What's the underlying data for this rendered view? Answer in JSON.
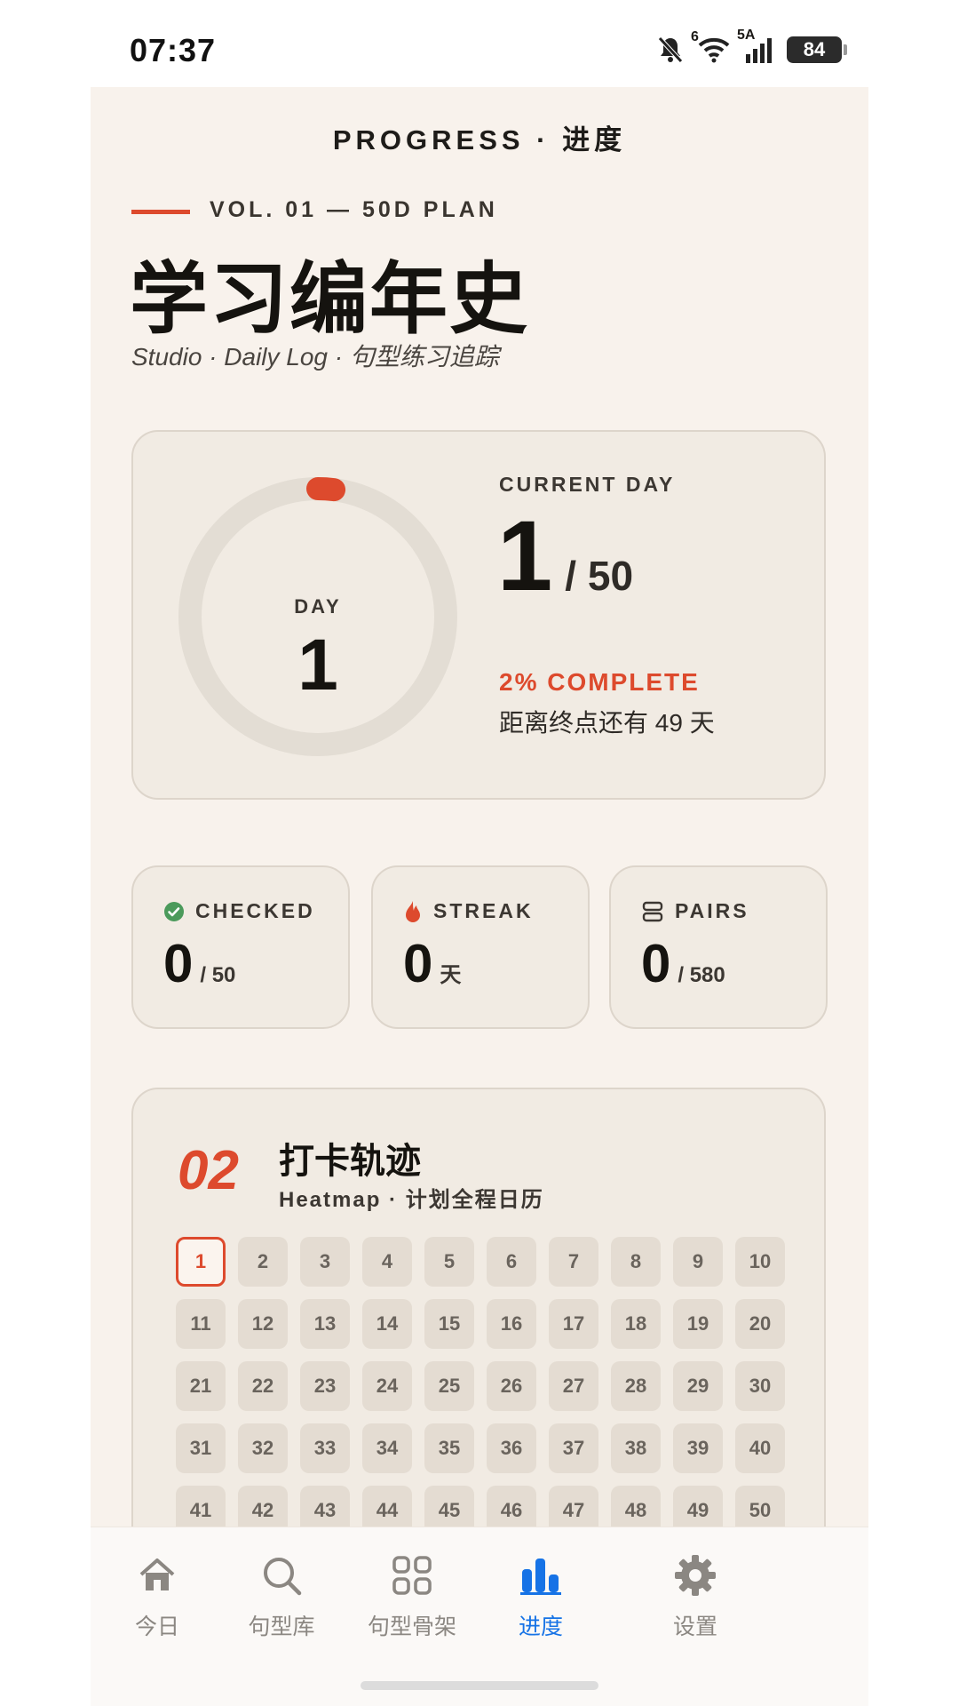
{
  "status_bar": {
    "time": "07:37",
    "network": "5A",
    "wifi": "6",
    "battery": "84",
    "icons": [
      "bell-muted-icon",
      "wifi-icon",
      "signal-icon",
      "battery-icon"
    ]
  },
  "header": {
    "title": "PROGRESS · 进度"
  },
  "hero_text": {
    "vol_label": "VOL. 01 — 50D PLAN",
    "title": "学习编年史",
    "subtitle": "Studio · Daily Log · 句型练习追踪"
  },
  "progress_card": {
    "ring_label": "DAY",
    "ring_value": "1",
    "progress_fraction": 0.02,
    "current_label": "CURRENT DAY",
    "current_value": "1",
    "current_total": "/ 50",
    "percent_text": "2% COMPLETE",
    "remaining_text": "距离终点还有 49 天"
  },
  "stats": [
    {
      "label": "CHECKED",
      "value": "0",
      "suffix": "/ 50",
      "icon": "check-circle-icon"
    },
    {
      "label": "STREAK",
      "value": "0",
      "suffix": "天",
      "icon": "flame-icon"
    },
    {
      "label": "PAIRS",
      "value": "0",
      "suffix": "/ 580",
      "icon": "stack-icon"
    }
  ],
  "heatmap": {
    "section_number": "02",
    "title": "打卡轨迹",
    "subtitle": "Heatmap · 计划全程日历",
    "current_day": 1,
    "days": [
      "1",
      "2",
      "3",
      "4",
      "5",
      "6",
      "7",
      "8",
      "9",
      "10",
      "11",
      "12",
      "13",
      "14",
      "15",
      "16",
      "17",
      "18",
      "19",
      "20",
      "21",
      "22",
      "23",
      "24",
      "25",
      "26",
      "27",
      "28",
      "29",
      "30",
      "31",
      "32",
      "33",
      "34",
      "35",
      "36",
      "37",
      "38",
      "39",
      "40",
      "41",
      "42",
      "43",
      "44",
      "45",
      "46",
      "47",
      "48",
      "49",
      "50"
    ]
  },
  "nav": {
    "items": [
      {
        "label": "今日",
        "icon": "home-icon"
      },
      {
        "label": "句型库",
        "icon": "search-icon"
      },
      {
        "label": "句型骨架",
        "icon": "grid-icon"
      },
      {
        "label": "进度",
        "icon": "bar-chart-icon",
        "active": true
      },
      {
        "label": "设置",
        "icon": "gear-icon"
      }
    ]
  },
  "colors": {
    "accent": "#dd4a2d",
    "background": "#f8f2ec",
    "card": "#f1ebe3",
    "nav_active": "#1673e6",
    "check_green": "#4b9a5b"
  }
}
